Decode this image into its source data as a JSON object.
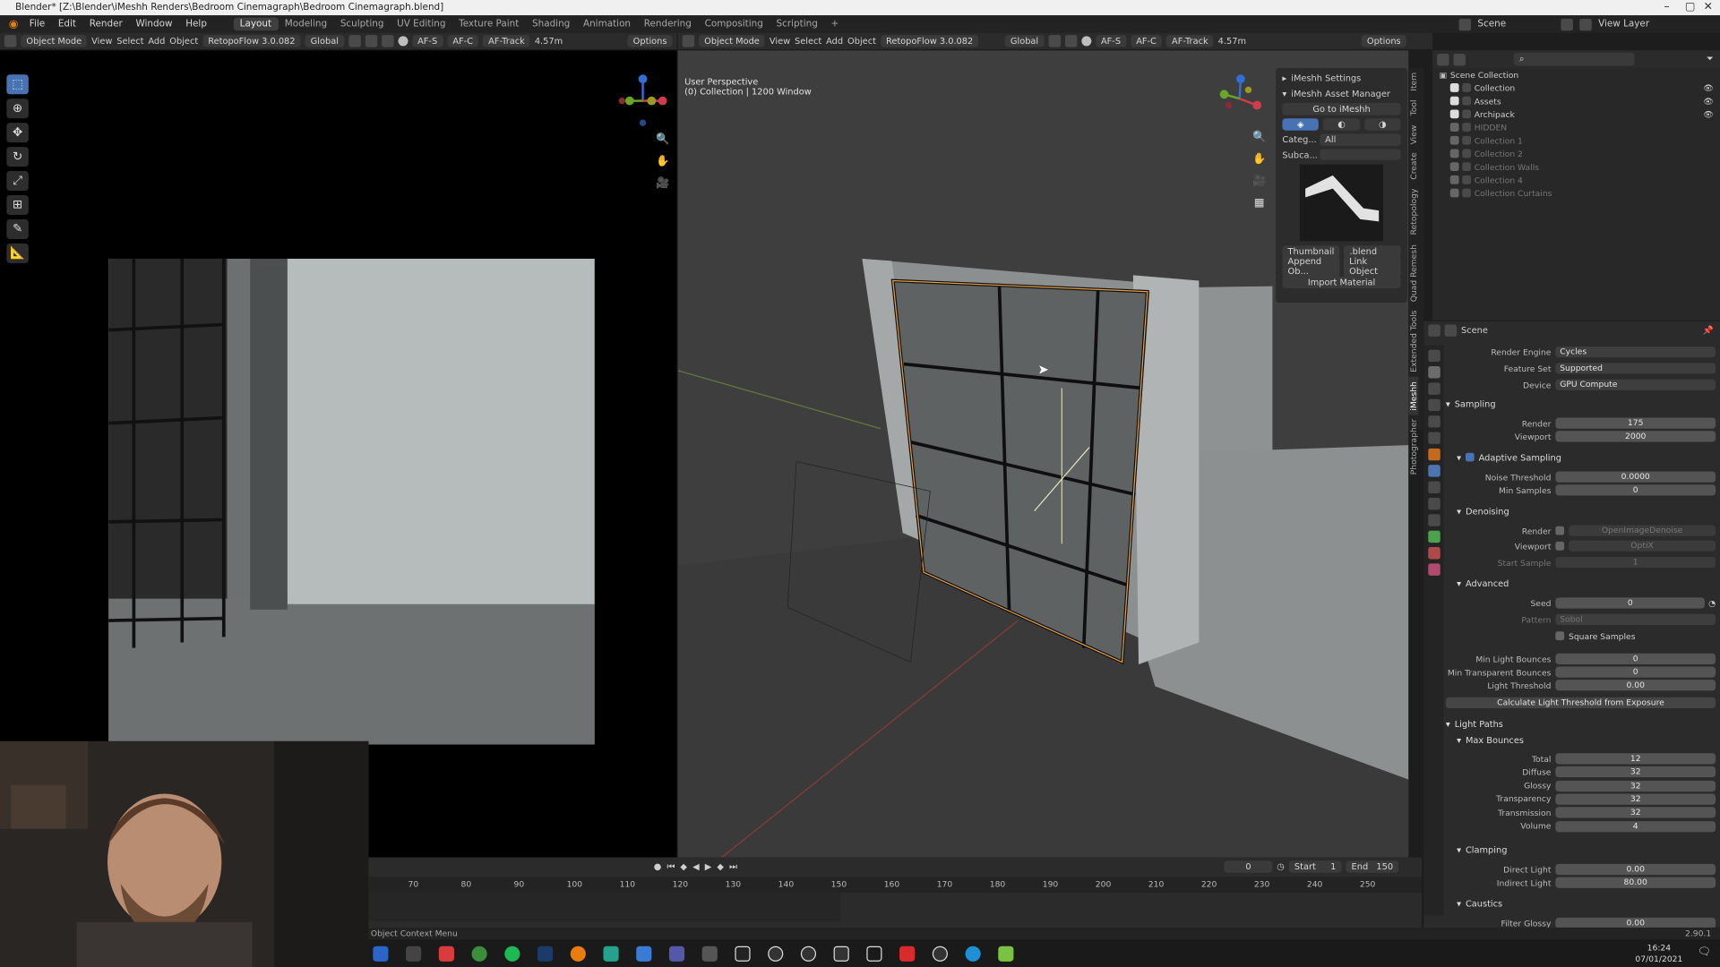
{
  "window": {
    "title": "Blender* [Z:\\Blender\\iMeshh Renders\\Bedroom Cinemagraph\\Bedroom Cinemagraph.blend]"
  },
  "menubar": {
    "menus": [
      "File",
      "Edit",
      "Render",
      "Window",
      "Help"
    ],
    "workspaces": [
      "Layout",
      "Modeling",
      "Sculpting",
      "UV Editing",
      "Texture Paint",
      "Shading",
      "Animation",
      "Rendering",
      "Compositing",
      "Scripting"
    ],
    "active_workspace": "Layout",
    "scene": "Scene",
    "view_layer": "View Layer"
  },
  "left_viewport": {
    "mode": "Object Mode",
    "menus": [
      "View",
      "Select",
      "Add",
      "Object"
    ],
    "addon": "RetopoFlow 3.0.082",
    "orientation": "Global",
    "af_s": "AF-S",
    "af_c": "AF-C",
    "af_track": "AF-Track",
    "distance": "4.57m",
    "options": "Options"
  },
  "right_viewport": {
    "mode": "Object Mode",
    "menus": [
      "View",
      "Select",
      "Add",
      "Object"
    ],
    "addon": "RetopoFlow 3.0.082",
    "orientation": "Global",
    "af_s": "AF-S",
    "af_c": "AF-C",
    "af_track": "AF-Track",
    "distance": "4.57m",
    "options": "Options",
    "overlay_line1": "User Perspective",
    "overlay_line2": "(0) Collection | 1200 Window"
  },
  "imeshh_panel": {
    "settings": "iMeshh Settings",
    "asset_manager": "iMeshh Asset Manager",
    "go_to": "Go to iMeshh",
    "category_label": "Categ...",
    "category_value": "All",
    "subcategory_label": "Subca...",
    "thumbnail": "Thumbnail",
    "blend": ".blend",
    "append": "Append Ob...",
    "link": "Link Object",
    "import_material": "Import Material"
  },
  "side_tabs": [
    "Item",
    "Tool",
    "View",
    "Create",
    "Retopology",
    "Quad Remesh",
    "Extended Tools",
    "iMeshh",
    "Photographer"
  ],
  "outliner": {
    "root": "Scene Collection",
    "items": [
      {
        "name": "Collection",
        "enabled": true
      },
      {
        "name": "Assets",
        "enabled": true
      },
      {
        "name": "Archipack",
        "enabled": true
      },
      {
        "name": "HIDDEN",
        "enabled": false
      },
      {
        "name": "Collection 1",
        "enabled": false
      },
      {
        "name": "Collection 2",
        "enabled": false
      },
      {
        "name": "Collection Walls",
        "enabled": false
      },
      {
        "name": "Collection 4",
        "enabled": false
      },
      {
        "name": "Collection Curtains",
        "enabled": false
      }
    ]
  },
  "properties": {
    "context": "Scene",
    "render_engine_label": "Render Engine",
    "render_engine": "Cycles",
    "feature_set_label": "Feature Set",
    "feature_set": "Supported",
    "device_label": "Device",
    "device": "GPU Compute",
    "sampling": "Sampling",
    "render_label": "Render",
    "render_samples": "175",
    "viewport_label": "Viewport",
    "viewport_samples": "2000",
    "adaptive_sampling": "Adaptive Sampling",
    "noise_threshold_label": "Noise Threshold",
    "noise_threshold": "0.0000",
    "min_samples_label": "Min Samples",
    "min_samples": "0",
    "denoising": "Denoising",
    "denoise_render": "OpenImageDenoise",
    "denoise_viewport": "OptiX",
    "start_sample_label": "Start Sample",
    "start_sample": "1",
    "advanced": "Advanced",
    "seed_label": "Seed",
    "seed": "0",
    "pattern_label": "Pattern",
    "pattern": "Sobol",
    "square_samples": "Square Samples",
    "min_light_bounces_label": "Min Light Bounces",
    "min_light_bounces": "0",
    "min_transparent_bounces_label": "Min Transparent Bounces",
    "min_transparent_bounces": "0",
    "light_threshold_label": "Light Threshold",
    "light_threshold": "0.00",
    "calc_threshold": "Calculate Light Threshold from Exposure",
    "light_paths": "Light Paths",
    "max_bounces": "Max Bounces",
    "bounces": [
      {
        "label": "Total",
        "value": "12"
      },
      {
        "label": "Diffuse",
        "value": "32"
      },
      {
        "label": "Glossy",
        "value": "32"
      },
      {
        "label": "Transparency",
        "value": "32"
      },
      {
        "label": "Transmission",
        "value": "32"
      },
      {
        "label": "Volume",
        "value": "4"
      }
    ],
    "clamping": "Clamping",
    "direct_light_label": "Direct Light",
    "direct_light": "0.00",
    "indirect_light_label": "Indirect Light",
    "indirect_light": "80.00",
    "caustics": "Caustics",
    "filter_glossy_label": "Filter Glossy",
    "filter_glossy": "0.00"
  },
  "timeline": {
    "current_frame": "0",
    "start_label": "Start",
    "start": "1",
    "end_label": "End",
    "end": "150",
    "ticks": [
      "70",
      "80",
      "90",
      "100",
      "110",
      "120",
      "130",
      "140",
      "150",
      "160",
      "170",
      "180",
      "190",
      "200",
      "210",
      "220",
      "230",
      "240",
      "250"
    ]
  },
  "status": {
    "left": "Object Context Menu",
    "version": "2.90.1"
  },
  "taskbar": {
    "time": "16:24",
    "date": "07/01/2021"
  }
}
